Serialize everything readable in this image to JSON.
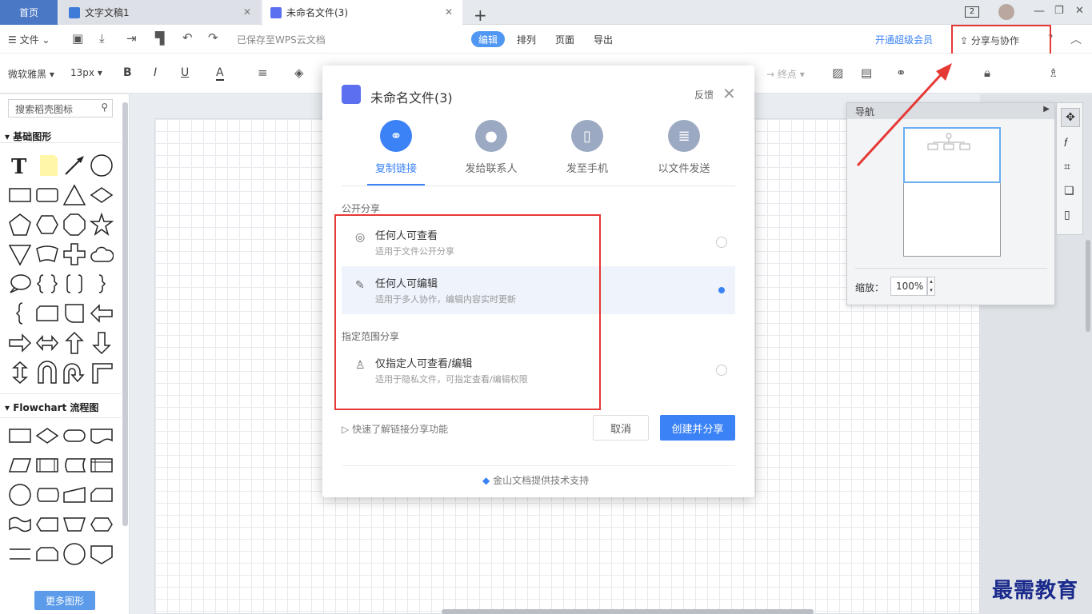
{
  "tabs": {
    "home": "首页",
    "doc": "文字文稿1",
    "active": "未命名文件(3)",
    "badge": "2"
  },
  "toolbar": {
    "file": "文件",
    "saved": "已保存至WPS云文档",
    "menus": [
      "编辑",
      "排列",
      "页面",
      "导出"
    ],
    "vip": "开通超级会员",
    "share": "分享与协作",
    "help": "?"
  },
  "format": {
    "font": "微软雅黑",
    "size": "13px",
    "bold": "B",
    "italic": "I",
    "underline": "U",
    "fontcolor": "A",
    "endpoint": "终点"
  },
  "left": {
    "search_placeholder": "搜索稻壳图标",
    "basic": "基础图形",
    "flow": "Flowchart 流程图",
    "more": "更多图形"
  },
  "nav": {
    "title": "导航",
    "zoom_label": "缩放：",
    "zoom": "100%"
  },
  "modal": {
    "title": "未命名文件(3)",
    "feedback": "反馈",
    "options": [
      "复制链接",
      "发给联系人",
      "发至手机",
      "以文件发送"
    ],
    "group_public": "公开分享",
    "group_range": "指定范围分享",
    "rows": [
      {
        "title": "任何人可查看",
        "sub": "适用于文件公开分享"
      },
      {
        "title": "任何人可编辑",
        "sub": "适用于多人协作，编辑内容实时更新"
      },
      {
        "title": "仅指定人可查看/编辑",
        "sub": "适用于隐私文件，可指定查看/编辑权限"
      }
    ],
    "help": "快速了解链接分享功能",
    "cancel": "取消",
    "create": "创建并分享",
    "footer": "金山文档提供技术支持"
  },
  "watermark": "最需教育",
  "colors": {
    "accent": "#3b82f6",
    "highlight": "#e53935",
    "tab_home": "#4a78c4"
  }
}
